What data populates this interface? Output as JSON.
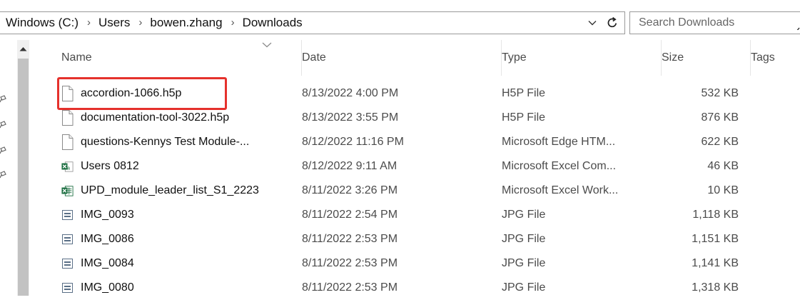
{
  "address_bar": {
    "crumbs": [
      {
        "label": "Windows (C:)"
      },
      {
        "label": "Users"
      },
      {
        "label": "bowen.zhang"
      },
      {
        "label": "Downloads"
      }
    ],
    "separator": "›",
    "dropdown_glyph": "⌄"
  },
  "search": {
    "placeholder": "Search Downloads"
  },
  "columns": {
    "name": "Name",
    "date": "Date",
    "type": "Type",
    "size": "Size",
    "tags": "Tags",
    "sort_indicator": "chevron-down-icon"
  },
  "files": [
    {
      "name": "accordion-1066.h5p",
      "date": "8/13/2022 4:00 PM",
      "type": "H5P File",
      "size": "532 KB",
      "icon": "blank-file-icon"
    },
    {
      "name": "documentation-tool-3022.h5p",
      "date": "8/13/2022 3:55 PM",
      "type": "H5P File",
      "size": "876 KB",
      "icon": "blank-file-icon"
    },
    {
      "name": "questions-Kennys Test Module-...",
      "date": "8/12/2022 11:16 PM",
      "type": "Microsoft Edge HTM...",
      "size": "622 KB",
      "icon": "blank-file-icon"
    },
    {
      "name": "Users 0812",
      "date": "8/12/2022 9:11 AM",
      "type": "Microsoft Excel Com...",
      "size": "46 KB",
      "icon": "excel-csv-icon"
    },
    {
      "name": "UPD_module_leader_list_S1_2223",
      "date": "8/11/2022 3:26 PM",
      "type": "Microsoft Excel Work...",
      "size": "10 KB",
      "icon": "excel-workbook-icon"
    },
    {
      "name": "IMG_0093",
      "date": "8/11/2022 2:54 PM",
      "type": "JPG File",
      "size": "1,118 KB",
      "icon": "image-file-icon"
    },
    {
      "name": "IMG_0086",
      "date": "8/11/2022 2:53 PM",
      "type": "JPG File",
      "size": "1,151 KB",
      "icon": "image-file-icon"
    },
    {
      "name": "IMG_0084",
      "date": "8/11/2022 2:53 PM",
      "type": "JPG File",
      "size": "1,141 KB",
      "icon": "image-file-icon"
    },
    {
      "name": "IMG_0080",
      "date": "8/11/2022 2:53 PM",
      "type": "JPG File",
      "size": "1,318 KB",
      "icon": "image-file-icon"
    }
  ],
  "highlight": {
    "target_row": 0,
    "color": "#e5312c"
  },
  "colors": {
    "excel_green": "#1d6f42",
    "scroll_track": "#f0f0f0",
    "scroll_thumb": "#c2c2c2"
  }
}
